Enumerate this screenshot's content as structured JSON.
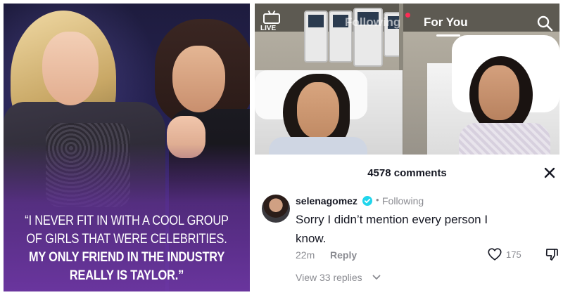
{
  "left_panel": {
    "quote_lines": [
      "“I NEVER FIT IN WITH A COOL GROUP",
      "OF GIRLS THAT WERE CELEBRITIES.",
      "MY ONLY FRIEND IN THE INDUSTRY",
      "REALLY IS TAYLOR.”"
    ]
  },
  "tiktok": {
    "top_bar": {
      "live_label": "LIVE",
      "tab_following": "Following",
      "tab_for_you": "For You",
      "active_tab": "For You",
      "icons": [
        "live-tv-icon",
        "search-icon"
      ]
    },
    "comments": {
      "count_label": "4578 comments",
      "items": [
        {
          "username": "selenagomez",
          "verified": true,
          "separator": "•",
          "status": "Following",
          "text": "Sorry I didn’t mention every person I know.",
          "timestamp": "22m",
          "reply_label": "Reply",
          "likes": "175",
          "view_replies": "View 33 replies"
        }
      ]
    },
    "colors": {
      "accent_red": "#fe2c55",
      "verified_blue": "#20d5ec",
      "text_primary": "#161823",
      "text_secondary": "#8a8b91"
    }
  }
}
